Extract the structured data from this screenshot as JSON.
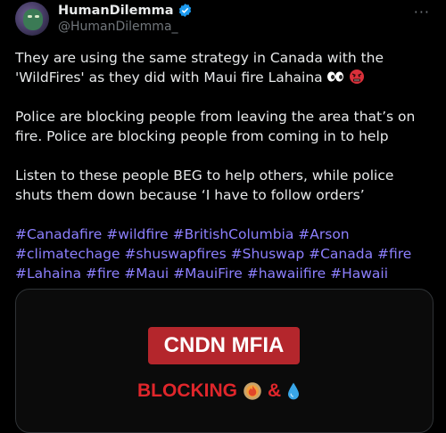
{
  "author": {
    "name": "HumanDilemma",
    "handle": "@HumanDilemma_"
  },
  "more_label": "···",
  "post": {
    "paragraphs": [
      "They are using the same strategy in Canada with the 'WildFires' as they did with Maui fire Lahaina",
      "Police are blocking people from leaving the area that’s on fire. Police are blocking people from coming in to help",
      "Listen to these people BEG to help others, while police shuts them down because ‘I have to follow orders’"
    ],
    "hashtags": "#Canadafire #wildfire #BritishColumbia #Arson #climatechage #shuswapfires #Shuswap #Canada #fire #Lahaina #fire #Maui #MauiFire #hawaiifire #Hawaii"
  },
  "media": {
    "banner_text": "CNDN MFIA",
    "caption_text": "BLOCKING",
    "caption_amp": "&"
  },
  "colors": {
    "background": "#000000",
    "text": "#e7e9ea",
    "secondary_text": "#71767b",
    "hashtag": "#8d80ff",
    "banner_red": "#b4262c",
    "caption_red": "#e0262b"
  },
  "icons": [
    "verified-badge-icon",
    "more-options-icon",
    "eyes-emoji-icon",
    "angry-face-emoji-icon",
    "fire-emoji-icon",
    "droplet-emoji-icon"
  ]
}
